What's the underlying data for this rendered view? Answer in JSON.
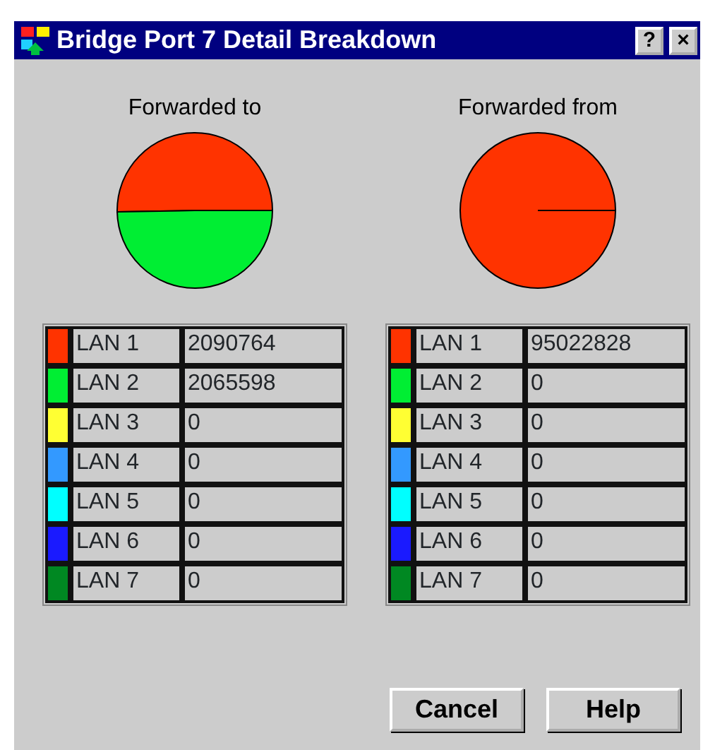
{
  "window": {
    "title": "Bridge Port 7 Detail Breakdown",
    "buttons": [
      "?",
      "×"
    ]
  },
  "panels": [
    {
      "title": "Forwarded to",
      "rows": [
        {
          "label": "LAN 1",
          "value": "2090764",
          "color": "#ff3300"
        },
        {
          "label": "LAN 2",
          "value": "2065598",
          "color": "#00ee33"
        },
        {
          "label": "LAN 3",
          "value": "0",
          "color": "#ffff33"
        },
        {
          "label": "LAN 4",
          "value": "0",
          "color": "#3399ff"
        },
        {
          "label": "LAN 5",
          "value": "0",
          "color": "#00ffff"
        },
        {
          "label": "LAN 6",
          "value": "0",
          "color": "#1a1aff"
        },
        {
          "label": "LAN 7",
          "value": "0",
          "color": "#008822"
        }
      ]
    },
    {
      "title": "Forwarded from",
      "rows": [
        {
          "label": "LAN 1",
          "value": "95022828",
          "color": "#ff3300"
        },
        {
          "label": "LAN 2",
          "value": "0",
          "color": "#00ee33"
        },
        {
          "label": "LAN 3",
          "value": "0",
          "color": "#ffff33"
        },
        {
          "label": "LAN 4",
          "value": "0",
          "color": "#3399ff"
        },
        {
          "label": "LAN 5",
          "value": "0",
          "color": "#00ffff"
        },
        {
          "label": "LAN 6",
          "value": "0",
          "color": "#1a1aff"
        },
        {
          "label": "LAN 7",
          "value": "0",
          "color": "#008822"
        }
      ]
    }
  ],
  "buttons": [
    "Cancel",
    "Help"
  ]
}
